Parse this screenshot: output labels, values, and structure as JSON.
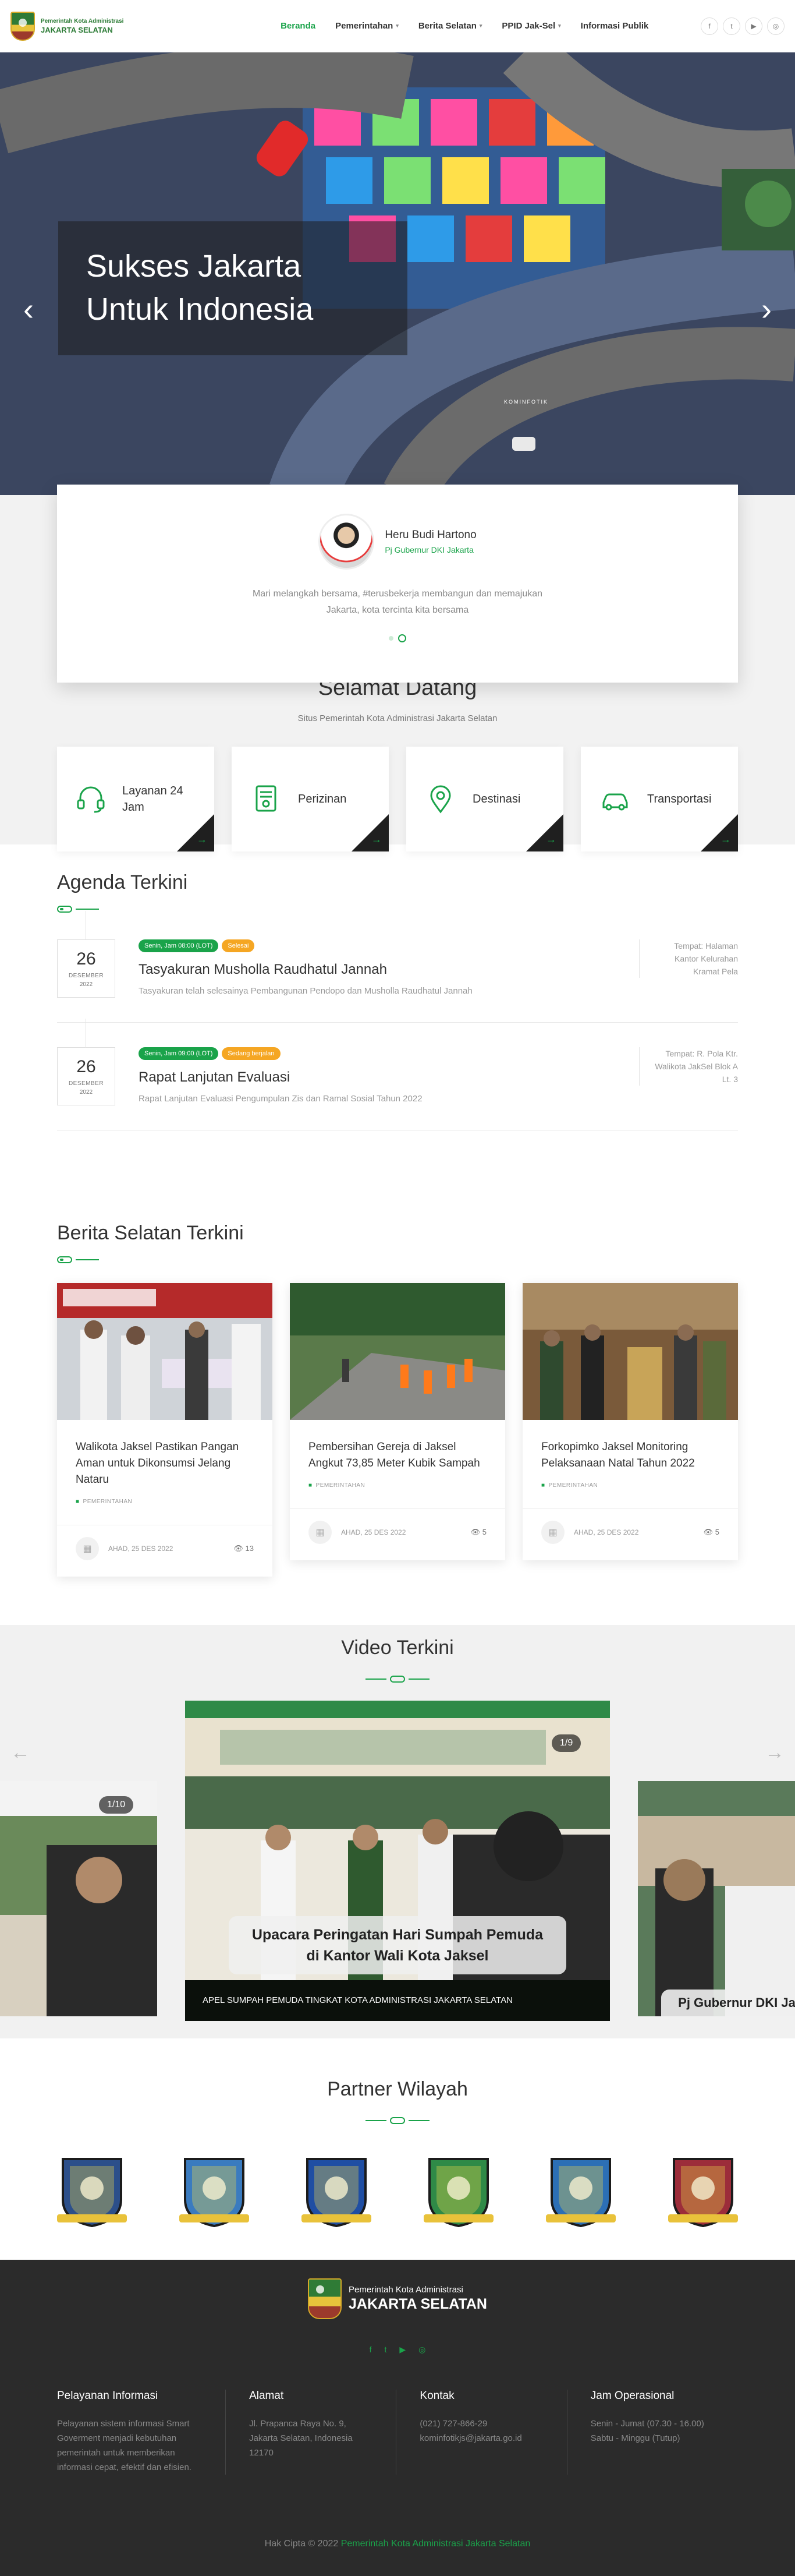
{
  "header": {
    "logo_line1": "Pemerintah Kota Administrasi",
    "logo_line2": "JAKARTA SELATAN",
    "nav": [
      {
        "label": "Beranda"
      },
      {
        "label": "Pemerintahan"
      },
      {
        "label": "Berita Selatan"
      },
      {
        "label": "PPID Jak-Sel"
      },
      {
        "label": "Informasi Publik"
      }
    ],
    "socials": [
      "f",
      "t",
      "▶",
      "◎"
    ]
  },
  "hero": {
    "line1": "Sukses Jakarta",
    "line2": "Untuk Indonesia",
    "tiny": "KOMINFOTIK"
  },
  "governor": {
    "name": "Heru Budi Hartono",
    "role": "Pj Gubernur DKI Jakarta",
    "quote": "Mari melangkah bersama, #terusbekerja membangun dan memajukan Jakarta, kota tercinta kita bersama"
  },
  "welcome": {
    "title": "Selamat Datang",
    "subtitle": "Situs Pemerintah Kota Administrasi Jakarta Selatan",
    "services": [
      {
        "label": "Layanan 24 Jam",
        "icon": "headset-icon"
      },
      {
        "label": "Perizinan",
        "icon": "document-icon"
      },
      {
        "label": "Destinasi",
        "icon": "map-pin-icon"
      },
      {
        "label": "Transportasi",
        "icon": "car-icon"
      }
    ]
  },
  "agenda": {
    "title": "Agenda Terkini",
    "items": [
      {
        "day": "26",
        "month": "DESEMBER",
        "year": "2022",
        "time": "Senin, Jam 08:00 (LOT)",
        "status": "Selesai",
        "title": "Tasyakuran Musholla Raudhatul Jannah",
        "desc": "Tasyakuran telah selesainya Pembangunan Pendopo dan Musholla Raudhatul Jannah",
        "place": "Tempat: Halaman Kantor Kelurahan Kramat Pela"
      },
      {
        "day": "26",
        "month": "DESEMBER",
        "year": "2022",
        "time": "Senin, Jam 09:00 (LOT)",
        "status": "Sedang berjalan",
        "title": "Rapat Lanjutan Evaluasi",
        "desc": "Rapat Lanjutan Evaluasi Pengumpulan Zis dan Ramal Sosial Tahun 2022",
        "place": "Tempat: R. Pola Ktr. Walikota JakSel Blok A Lt. 3"
      }
    ]
  },
  "news": {
    "title": "Berita Selatan Terkini",
    "items": [
      {
        "title": "Walikota Jaksel Pastikan Pangan Aman untuk Dikonsumsi Jelang Nataru",
        "category": "PEMERINTAHAN",
        "date": "AHAD, 25 DES 2022",
        "views": "13"
      },
      {
        "title": "Pembersihan Gereja di Jaksel Angkut 73,85 Meter Kubik Sampah",
        "category": "PEMERINTAHAN",
        "date": "AHAD, 25 DES 2022",
        "views": "5"
      },
      {
        "title": "Forkopimko Jaksel Monitoring Pelaksanaan Natal Tahun 2022",
        "category": "PEMERINTAHAN",
        "date": "AHAD, 25 DES 2022",
        "views": "5"
      }
    ]
  },
  "video": {
    "title": "Video Terkini",
    "main_counter": "1/9",
    "main_overlay": "Upacara Peringatan Hari Sumpah Pemuda di Kantor Wali Kota Jaksel",
    "main_caption": "APEL SUMPAH PEMUDA TINGKAT KOTA ADMINISTRASI JAKARTA SELATAN",
    "left_counter": "1/10",
    "right_overlay": "Pj Gubernur DKI Ja"
  },
  "partner": {
    "title": "Partner Wilayah",
    "logos": [
      "crest-1",
      "crest-2",
      "crest-3",
      "crest-4",
      "crest-5",
      "crest-6"
    ],
    "colors": [
      "#2c4f8a",
      "#3a7bbf",
      "#1f4ea3",
      "#2f8a47",
      "#2c6fb5",
      "#9c2d3a"
    ]
  },
  "footer": {
    "logo_line1": "Pemerintah Kota Administrasi",
    "logo_line2": "JAKARTA SELATAN",
    "socials": [
      "f",
      "t",
      "▶",
      "◎"
    ],
    "cols": [
      {
        "title": "Pelayanan Informasi",
        "text": "Pelayanan sistem informasi Smart Goverment menjadi kebutuhan pemerintah untuk memberikan informasi cepat, efektif dan efisien."
      },
      {
        "title": "Alamat",
        "text": "Jl. Prapanca Raya No. 9,\nJakarta Selatan, Indonesia\n12170"
      },
      {
        "title": "Kontak",
        "text": "(021) 727-866-29\nkominfotikjs@jakarta.go.id"
      },
      {
        "title": "Jam Operasional",
        "text": "Senin - Jumat (07.30 - 16.00)\nSabtu - Minggu (Tutup)"
      }
    ],
    "copyright_prefix": "Hak Cipta © 2022",
    "copyright_link": "Pemerintah Kota Administrasi Jakarta Selatan"
  }
}
